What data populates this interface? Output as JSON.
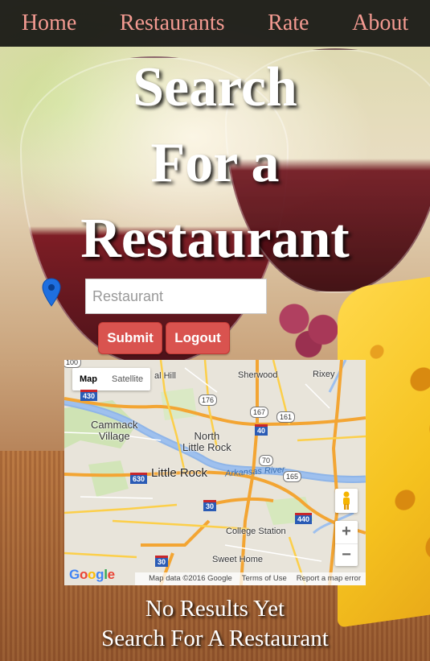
{
  "nav": {
    "items": [
      "Home",
      "Restaurants",
      "Rate",
      "About"
    ],
    "link_color": "#f39a91"
  },
  "hero": {
    "title_line1": "Search",
    "title_line2": "For a",
    "title_line3": "Restaurant"
  },
  "search": {
    "placeholder": "Restaurant",
    "value": ""
  },
  "buttons": {
    "submit": "Submit",
    "logout": "Logout",
    "color": "#d9534f"
  },
  "map": {
    "type_map": "Map",
    "type_satellite": "Satellite",
    "places": {
      "cammack_village": "Cammack\nVillage",
      "north_little_rock": "North\nLittle Rock",
      "little_rock": "Little Rock",
      "sherwood": "Sherwood",
      "rixey": "Rixey",
      "hill": "al Hill",
      "college_station": "College Station",
      "sweet_home": "Sweet Home",
      "river": "Arkansas River"
    },
    "shields": [
      "430",
      "176",
      "167",
      "161",
      "40",
      "70",
      "165",
      "630",
      "30",
      "440",
      "30",
      "100"
    ],
    "zoom_in": "+",
    "zoom_out": "−",
    "attribution": "Map data ©2016 Google",
    "terms": "Terms of Use",
    "report": "Report a map error",
    "logo": [
      "G",
      "o",
      "o",
      "g",
      "l",
      "e"
    ]
  },
  "results": {
    "line1": "No Results Yet",
    "line2": "Search For A Restaurant"
  }
}
